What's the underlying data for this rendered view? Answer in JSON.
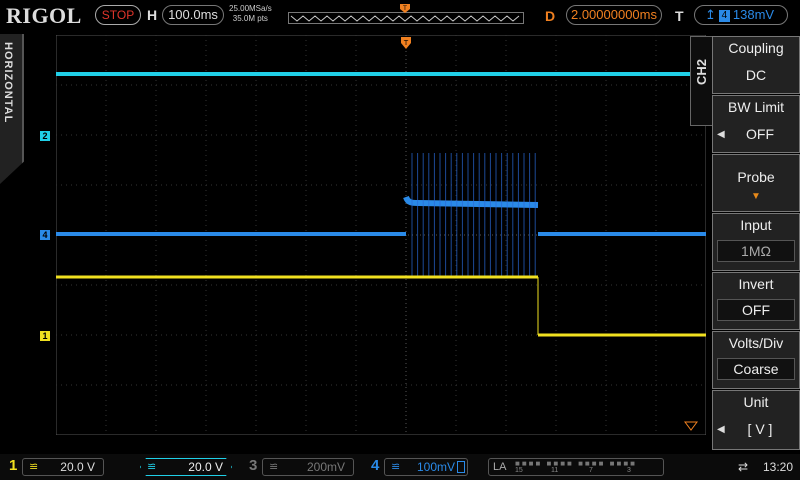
{
  "header": {
    "brand": "RIGOL",
    "run_status": "STOP",
    "horizontal_label": "H",
    "timebase": "100.0ms",
    "sample_rate": "25.00MSa/s",
    "memory_depth": "35.0M pts",
    "delay_label": "D",
    "delay": "2.00000000ms",
    "trigger_label": "T",
    "trigger_source": "4",
    "trigger_level": "138mV"
  },
  "side_tab": {
    "label": "HORIZONTAL"
  },
  "channel_markers": [
    {
      "id": "2",
      "color": "#20d0e8"
    },
    {
      "id": "4",
      "color": "#2a8ae8"
    },
    {
      "id": "1",
      "color": "#f0e020"
    }
  ],
  "menu": {
    "title": "CH2",
    "items": [
      {
        "title": "Coupling",
        "value": "DC"
      },
      {
        "title": "BW Limit",
        "value": "OFF"
      },
      {
        "title": "Probe",
        "value": ""
      },
      {
        "title": "Input",
        "value": "1MΩ"
      },
      {
        "title": "Invert",
        "value": "OFF"
      },
      {
        "title": "Volts/Div",
        "value": "Coarse"
      },
      {
        "title": "Unit",
        "value": "[ V ]"
      }
    ]
  },
  "channels": [
    {
      "num": "1",
      "scale": "20.0 V",
      "color": "#f0e020"
    },
    {
      "num": "2",
      "scale": "20.0 V",
      "color": "#20d0e8"
    },
    {
      "num": "3",
      "scale": "200mV",
      "color": "#777777"
    },
    {
      "num": "4",
      "scale": "100mV",
      "color": "#2a8ae8"
    }
  ],
  "la": {
    "label": "LA",
    "groups": [
      "15",
      "11",
      "7",
      "3"
    ]
  },
  "status": {
    "time": "13:20"
  },
  "colors": {
    "ch1": "#f0e020",
    "ch2": "#20d0e8",
    "ch4": "#2a8ae8",
    "trigger": "#f08020",
    "stop": "#e0352b"
  }
}
